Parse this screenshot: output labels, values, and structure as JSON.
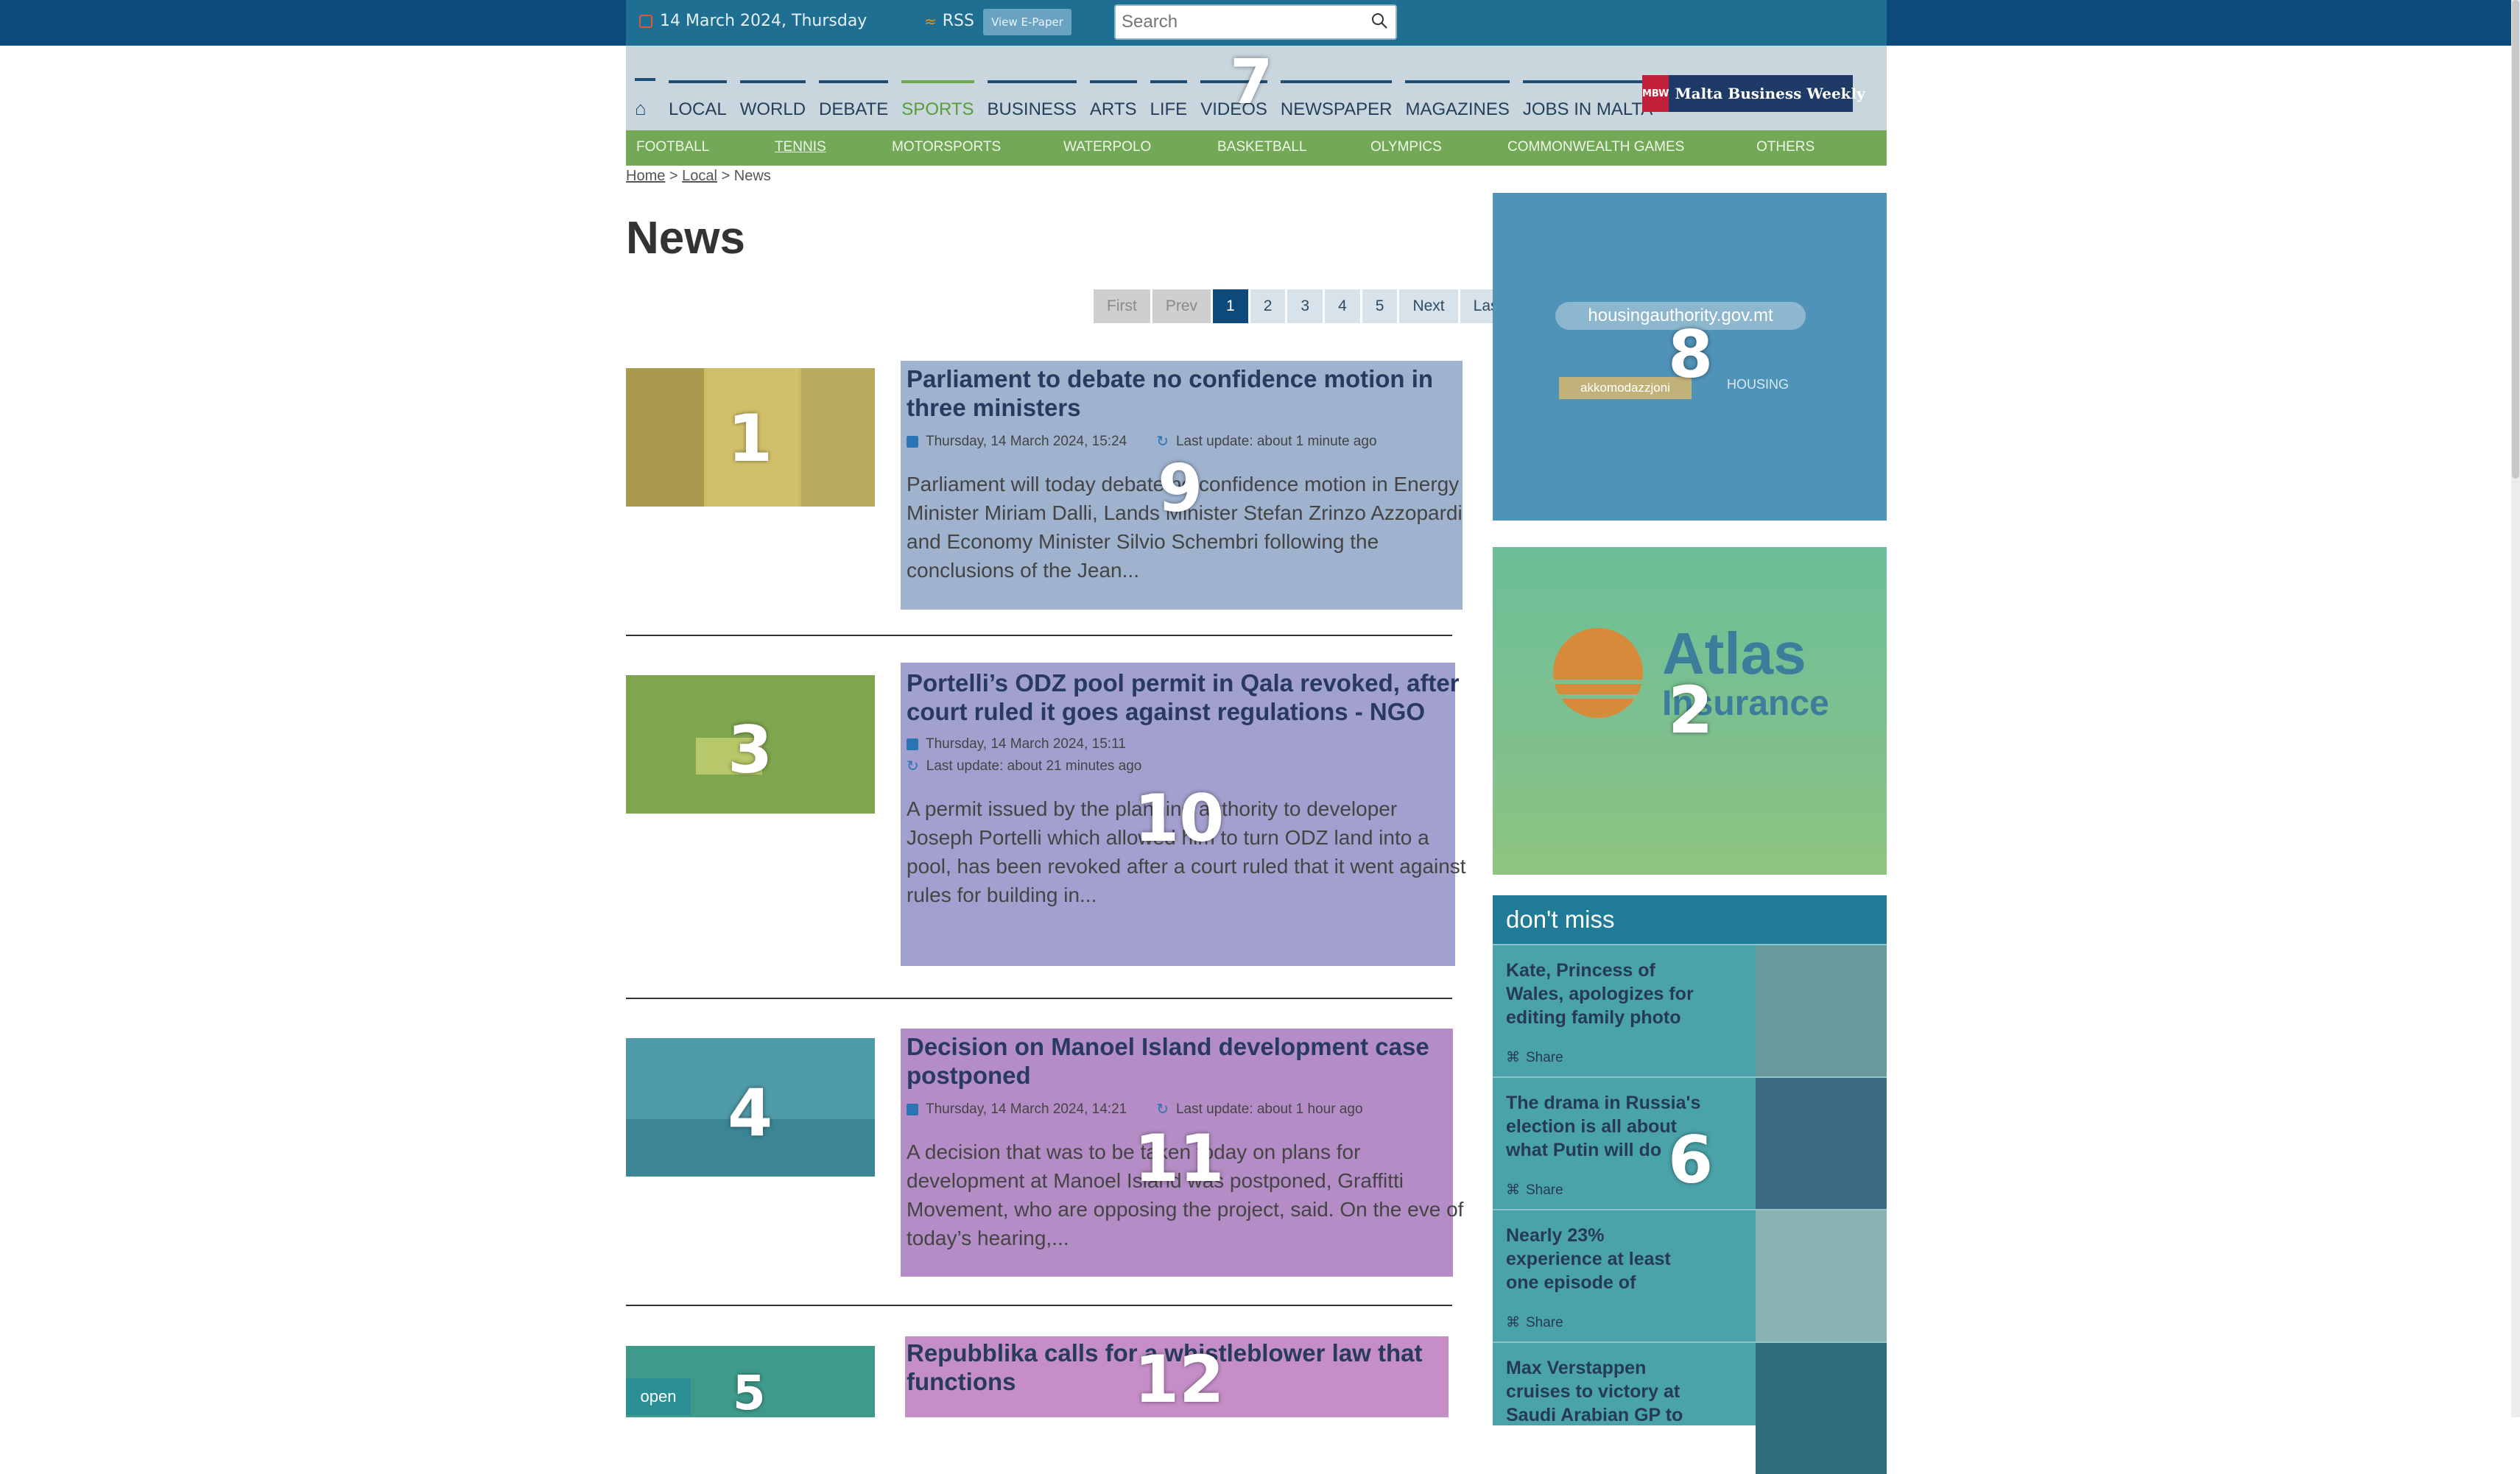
{
  "topbar": {
    "date": "14 March 2024, Thursday",
    "rss_label": "RSS",
    "epaper_label": "View E-Paper",
    "search_placeholder": "Search"
  },
  "nav": {
    "items": [
      "LOCAL",
      "WORLD",
      "DEBATE",
      "SPORTS",
      "BUSINESS",
      "ARTS",
      "LIFE",
      "VIDEOS",
      "NEWSPAPER",
      "MAGAZINES",
      "JOBS IN MALTA"
    ],
    "active": "SPORTS",
    "mbw_logo": "MBW",
    "mbw_label": "Malta Business Weekly"
  },
  "subnav": {
    "items": [
      "FOOTBALL",
      "TENNIS",
      "MOTORSPORTS",
      "WATERPOLO",
      "BASKETBALL",
      "OLYMPICS",
      "COMMONWEALTH GAMES",
      "OTHERS"
    ],
    "active": "TENNIS"
  },
  "breadcrumb": {
    "home": "Home",
    "local": "Local",
    "current": "News",
    "sep": ">"
  },
  "page_title": "News",
  "pagination": [
    "First",
    "Prev",
    "1",
    "2",
    "3",
    "4",
    "5",
    "Next",
    "Last"
  ],
  "articles": [
    {
      "title": "Parliament to debate no confidence motion in three ministers",
      "date": "Thursday, 14 March 2024, 15:24",
      "update": "Last update: about 1 minute ago",
      "excerpt": "Parliament will today debate no confidence motion in Energy Minister Miriam Dalli, Lands Minister Stefan Zrinzo Azzopardi and Economy Minister Silvio Schembri following the conclusions of the Jean..."
    },
    {
      "title": "Portelli’s ODZ pool permit in Qala revoked, after court ruled it goes against regulations - NGO",
      "date": "Thursday, 14 March 2024, 15:11",
      "update": "Last update: about 21 minutes ago",
      "excerpt": "A permit issued by the planning authority to developer Joseph Portelli which allowed him to turn ODZ land into a pool, has been revoked after a court ruled that it went against rules for building in..."
    },
    {
      "title": "Decision on Manoel Island development case postponed",
      "date": "Thursday, 14 March 2024, 14:21",
      "update": "Last update: about 1 hour ago",
      "excerpt": "A decision that was to be taken today on plans for development at Manoel Island was postponed, Graffitti Movement, who are opposing the project, said. On the eve of today’s hearing,..."
    },
    {
      "title": "Repubblika calls for a whistleblower law that functions",
      "date": "",
      "update": "",
      "excerpt": ""
    }
  ],
  "open_badge": "open",
  "ads": {
    "housing_url": "housingauthority.gov.mt",
    "housing_tag": "akkomodazzjoni",
    "housing_logo": "HOUSING",
    "atlas_title": "Atlas",
    "atlas_sub": "Insurance"
  },
  "dont_miss": {
    "heading": "don't miss",
    "share_label": "Share",
    "items": [
      "Kate, Princess of Wales, apologizes for editing family photo",
      "The drama in Russia's election is all about what Putin will do",
      "Nearly 23% experience at least one episode of",
      "Max Verstappen cruises to victory at Saudi Arabian GP to"
    ]
  },
  "markers": [
    "1",
    "2",
    "3",
    "4",
    "5",
    "6",
    "7",
    "8",
    "9",
    "10",
    "11",
    "12"
  ],
  "colors": {
    "top_bar": "#0b4a7a",
    "active_nav": "#5a9c3b",
    "subnav_bg": "#73a956",
    "current_page": "#0d4a7c"
  }
}
